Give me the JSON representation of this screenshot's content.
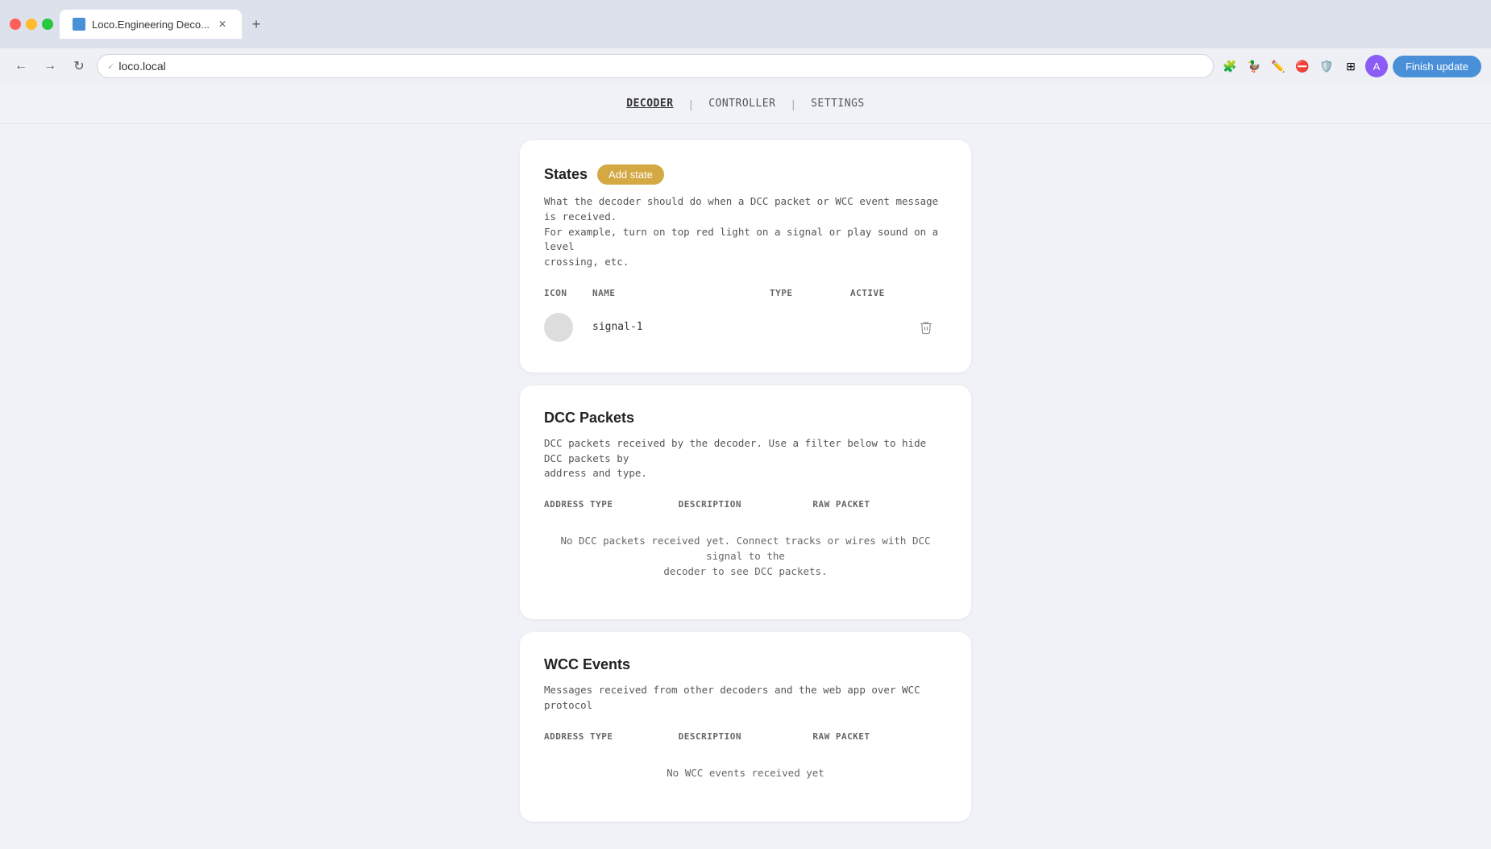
{
  "browser": {
    "tab_title": "Loco.Engineering Deco...",
    "tab_favicon": "L",
    "url": "loco.local",
    "finish_update_label": "Finish update"
  },
  "nav": {
    "links": [
      {
        "id": "decoder",
        "label": "DECODER",
        "active": true
      },
      {
        "id": "controller",
        "label": "CONTROLLER",
        "active": false
      },
      {
        "id": "settings",
        "label": "SETTINGS",
        "active": false
      }
    ]
  },
  "states_section": {
    "title": "States",
    "add_button_label": "Add state",
    "description": "What the decoder should do when a DCC packet or WCC event message is received.\nFor example, turn on top red light on a signal or play sound on a level\ncrossing, etc.",
    "columns": [
      {
        "id": "icon",
        "label": "ICON"
      },
      {
        "id": "name",
        "label": "NAME"
      },
      {
        "id": "type",
        "label": "TYPE"
      },
      {
        "id": "active",
        "label": "ACTIVE"
      }
    ],
    "rows": [
      {
        "icon": "",
        "name": "signal-1",
        "type": "",
        "active": ""
      }
    ]
  },
  "dcc_packets_section": {
    "title": "DCC Packets",
    "description": "DCC packets received by the decoder. Use a filter below to hide DCC packets by\naddress and type.",
    "columns": [
      {
        "id": "address_type",
        "label": "ADDRESS TYPE"
      },
      {
        "id": "description",
        "label": "DESCRIPTION"
      },
      {
        "id": "raw_packet",
        "label": "RAW PACKET"
      }
    ],
    "empty_message": "No DCC packets received yet. Connect tracks or wires with DCC signal to the\ndecoder to see DCC packets."
  },
  "wcc_events_section": {
    "title": "WCC Events",
    "description": "Messages received from other decoders and the web app over WCC protocol",
    "columns": [
      {
        "id": "address_type",
        "label": "ADDRESS TYPE"
      },
      {
        "id": "description",
        "label": "DESCRIPTION"
      },
      {
        "id": "raw_packet",
        "label": "RAW PACKET"
      }
    ],
    "empty_message": "No WCC events received yet"
  }
}
